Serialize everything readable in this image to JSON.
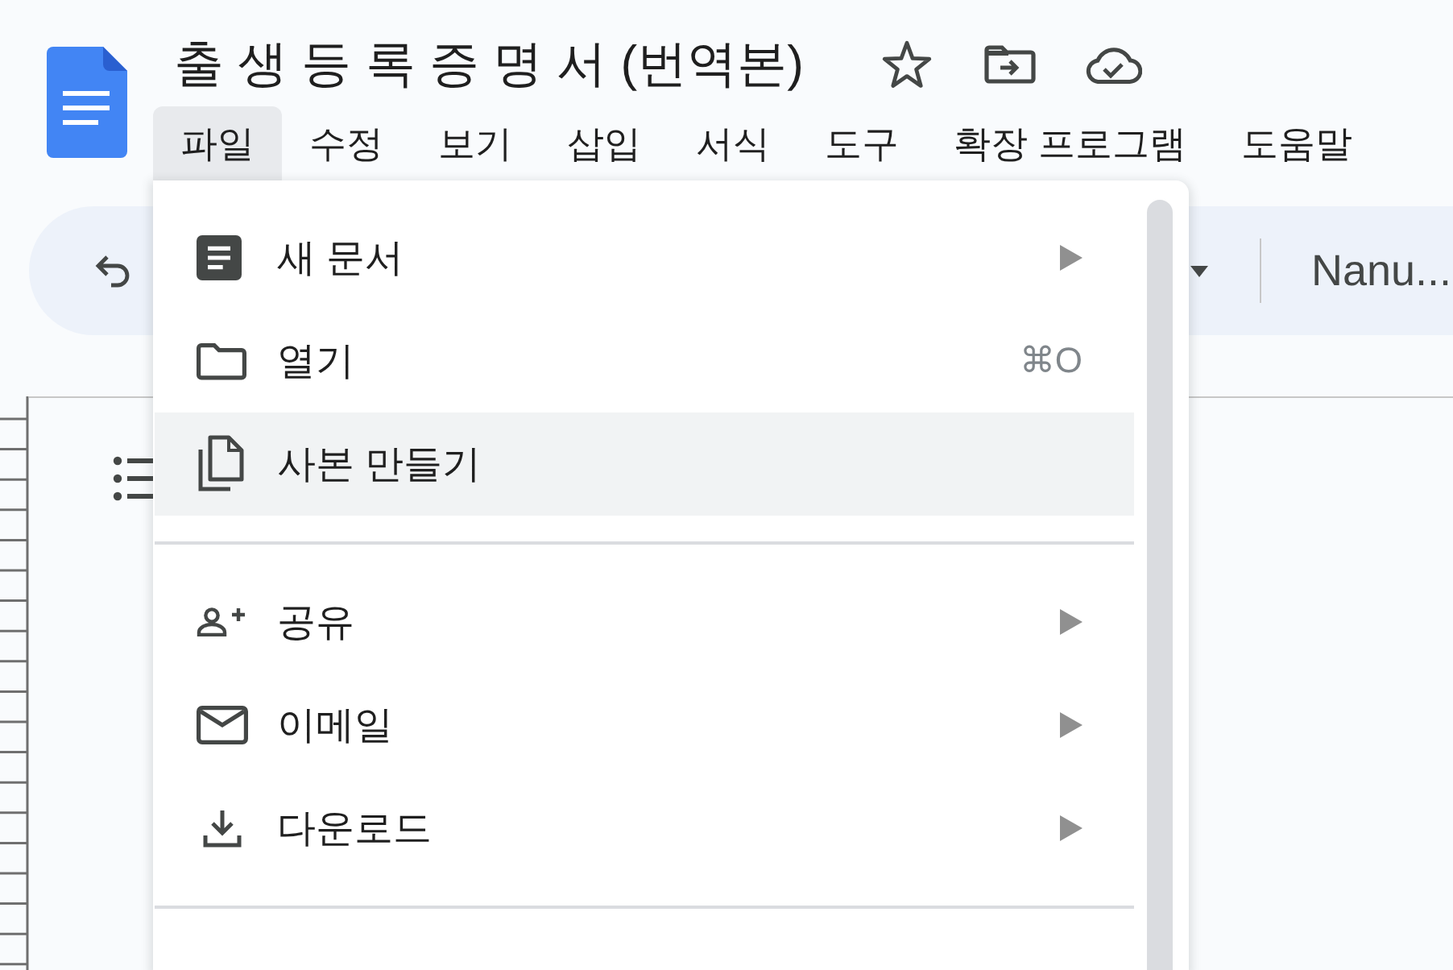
{
  "document": {
    "title": "출 생 등 록 증 명 서 (번역본)"
  },
  "menu_bar": [
    {
      "label": "파일",
      "selected": true
    },
    {
      "label": "수정",
      "selected": false
    },
    {
      "label": "보기",
      "selected": false
    },
    {
      "label": "삽입",
      "selected": false
    },
    {
      "label": "서식",
      "selected": false
    },
    {
      "label": "도구",
      "selected": false
    },
    {
      "label": "확장 프로그램",
      "selected": false
    },
    {
      "label": "도움말",
      "selected": false
    }
  ],
  "toolbar": {
    "font": "Nanu..."
  },
  "file_menu": {
    "sections": [
      {
        "items": [
          {
            "label": "새 문서",
            "submenu": true,
            "highlighted": false
          },
          {
            "label": "열기",
            "shortcut": "⌘O",
            "submenu": false,
            "highlighted": false
          },
          {
            "label": "사본 만들기",
            "submenu": false,
            "highlighted": true
          }
        ]
      },
      {
        "items": [
          {
            "label": "공유",
            "submenu": true,
            "highlighted": false
          },
          {
            "label": "이메일",
            "submenu": true,
            "highlighted": false
          },
          {
            "label": "다운로드",
            "submenu": true,
            "highlighted": false
          }
        ]
      }
    ]
  }
}
